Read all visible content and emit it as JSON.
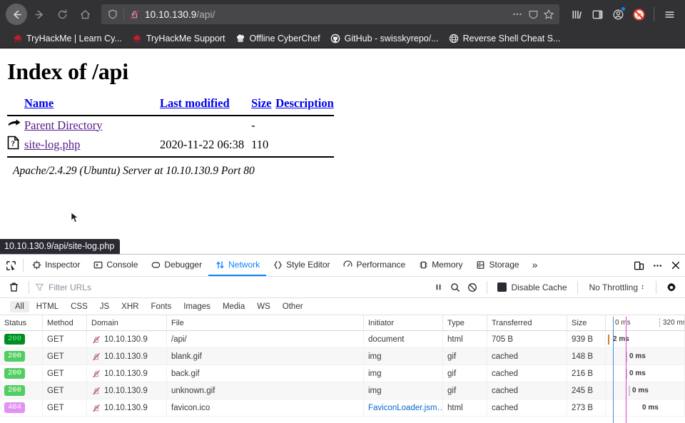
{
  "browser": {
    "nav": {
      "back_label": "Back",
      "forward_label": "Forward",
      "reload_label": "Reload",
      "home_label": "Home"
    },
    "urlbar": {
      "host": "10.10.130.9",
      "path": "/api/",
      "shield_icon": "shield-icon",
      "lock_icon": "insecure-lock-icon",
      "page_actions_icon": "ellipsis-icon",
      "reader_icon": "reader-view-icon",
      "bookmark_icon": "star-icon"
    },
    "toolbar_right": {
      "library_icon": "library-icon",
      "sidebars_icon": "sidebars-icon",
      "account_icon": "account-icon",
      "extension_icon": "blocker-extension-icon",
      "menu_icon": "hamburger-menu-icon"
    },
    "bookmarks": [
      {
        "label": "TryHackMe | Learn Cy...",
        "icon": "tryhackme-icon"
      },
      {
        "label": "TryHackMe Support",
        "icon": "tryhackme-icon"
      },
      {
        "label": "Offline CyberChef",
        "icon": "cyberchef-icon"
      },
      {
        "label": "GitHub - swisskyrepo/...",
        "icon": "github-icon"
      },
      {
        "label": "Reverse Shell Cheat S...",
        "icon": "globe-icon"
      }
    ]
  },
  "page": {
    "title": "Index of /api",
    "columns": {
      "name": "Name",
      "last_modified": "Last modified",
      "size": "Size",
      "description": "Description"
    },
    "entries": [
      {
        "icon": "parent-directory-icon",
        "name": "Parent Directory",
        "last_modified": "",
        "size": "-",
        "description": ""
      },
      {
        "icon": "unknown-file-icon",
        "name": "site-log.php",
        "last_modified": "2020-11-22 06:38",
        "size": "110",
        "description": ""
      }
    ],
    "signature": "Apache/2.4.29 (Ubuntu) Server at 10.10.130.9 Port 80",
    "status_tooltip": "10.10.130.9/api/site-log.php"
  },
  "devtools": {
    "picker_icon": "element-picker-icon",
    "tabs": [
      {
        "label": "Inspector",
        "icon": "inspector-icon",
        "active": false
      },
      {
        "label": "Console",
        "icon": "console-icon",
        "active": false
      },
      {
        "label": "Debugger",
        "icon": "debugger-icon",
        "active": false
      },
      {
        "label": "Network",
        "icon": "network-icon",
        "active": true
      },
      {
        "label": "Style Editor",
        "icon": "style-editor-icon",
        "active": false
      },
      {
        "label": "Performance",
        "icon": "performance-icon",
        "active": false
      },
      {
        "label": "Memory",
        "icon": "memory-icon",
        "active": false
      },
      {
        "label": "Storage",
        "icon": "storage-icon",
        "active": false
      }
    ],
    "overflow_label": "»",
    "right_buttons": {
      "responsive_mode_icon": "responsive-design-mode-icon",
      "more_icon": "meatball-menu-icon",
      "close_icon": "close-icon"
    },
    "toolbar": {
      "clear_icon": "trash-icon",
      "filter_icon": "funnel-icon",
      "filter_placeholder": "Filter URLs",
      "filter_value": "",
      "pause_icon": "pause-icon",
      "search_icon": "search-icon",
      "block_icon": "block-requests-icon",
      "disable_cache_label": "Disable Cache",
      "disable_cache_checked": true,
      "throttling_value": "No Throttling",
      "throttling_caret": "↕",
      "settings_icon": "gear-icon"
    },
    "filters": [
      {
        "label": "All",
        "active": true
      },
      {
        "label": "HTML",
        "active": false
      },
      {
        "label": "CSS",
        "active": false
      },
      {
        "label": "JS",
        "active": false
      },
      {
        "label": "XHR",
        "active": false
      },
      {
        "label": "Fonts",
        "active": false
      },
      {
        "label": "Images",
        "active": false
      },
      {
        "label": "Media",
        "active": false
      },
      {
        "label": "WS",
        "active": false
      },
      {
        "label": "Other",
        "active": false
      }
    ],
    "table": {
      "headers": {
        "status": "Status",
        "method": "Method",
        "domain": "Domain",
        "file": "File",
        "initiator": "Initiator",
        "type": "Type",
        "transferred": "Transferred",
        "size": "Size"
      },
      "timeline": {
        "start_label": "0 ms",
        "end_label": "320 ms"
      },
      "rows": [
        {
          "status": "200",
          "status_class": "s200-strong",
          "method": "GET",
          "domain": "10.10.130.9",
          "file": "/api/",
          "initiator": "document",
          "initiator_link": false,
          "type": "html",
          "transferred": "705 B",
          "size": "939 B",
          "time": "2 ms"
        },
        {
          "status": "200",
          "status_class": "s200",
          "method": "GET",
          "domain": "10.10.130.9",
          "file": "blank.gif",
          "initiator": "img",
          "initiator_link": false,
          "type": "gif",
          "transferred": "cached",
          "size": "148 B",
          "time": "0 ms"
        },
        {
          "status": "200",
          "status_class": "s200",
          "method": "GET",
          "domain": "10.10.130.9",
          "file": "back.gif",
          "initiator": "img",
          "initiator_link": false,
          "type": "gif",
          "transferred": "cached",
          "size": "216 B",
          "time": "0 ms"
        },
        {
          "status": "200",
          "status_class": "s200",
          "method": "GET",
          "domain": "10.10.130.9",
          "file": "unknown.gif",
          "initiator": "img",
          "initiator_link": false,
          "type": "gif",
          "transferred": "cached",
          "size": "245 B",
          "time": "0 ms"
        },
        {
          "status": "404",
          "status_class": "s404",
          "method": "GET",
          "domain": "10.10.130.9",
          "file": "favicon.ico",
          "initiator": "FaviconLoader.jsm…",
          "initiator_link": true,
          "type": "html",
          "transferred": "cached",
          "size": "273 B",
          "time": "0 ms"
        }
      ]
    }
  },
  "colors": {
    "chrome_bg": "#323234",
    "accent_blue": "#0a84ff",
    "status_200": "#51cd62",
    "status_200_strong": "#038b25",
    "status_404": "#e292f5",
    "link_purple": "#551a8b",
    "link_blue": "#0000ee",
    "timeline_dom": "#4a8fd4",
    "timeline_load": "#e637d9"
  }
}
